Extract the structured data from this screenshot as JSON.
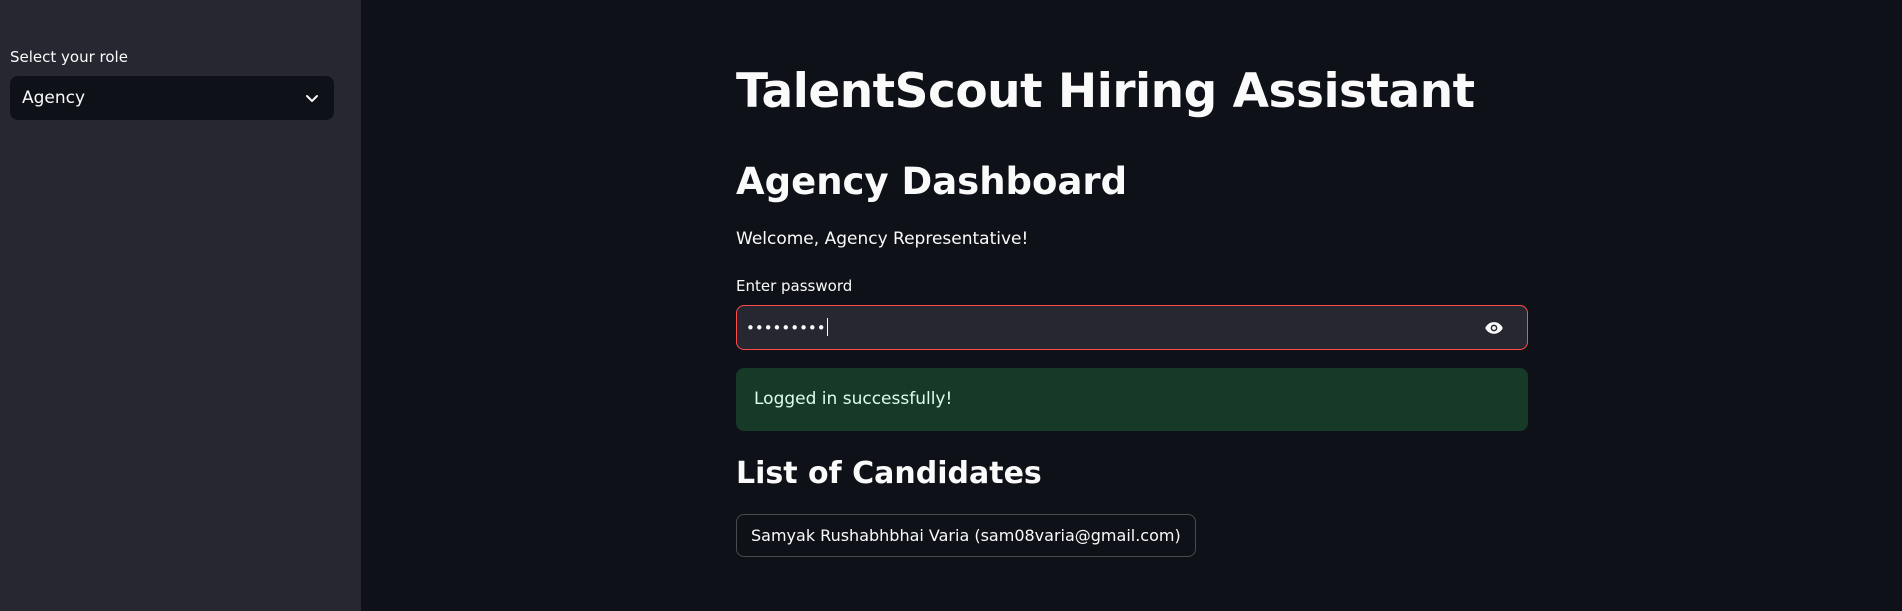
{
  "sidebar": {
    "role_label": "Select your role",
    "role_selected": "Agency"
  },
  "main": {
    "title": "TalentScout Hiring Assistant",
    "subtitle": "Agency Dashboard",
    "welcome": "Welcome, Agency Representative!",
    "password_label": "Enter password",
    "password_value": "•••••••••",
    "success_message": "Logged in successfully!",
    "list_title": "List of Candidates",
    "candidates": [
      "Samyak Rushabhbhai Varia (sam08varia@gmail.com)"
    ]
  },
  "colors": {
    "background": "#0e1117",
    "sidebar": "#262730",
    "input_border_error": "#ff4b4b",
    "success_bg": "#173928",
    "success_text": "#dffde9"
  },
  "icons": {
    "select_chevron": "chevron-down-icon",
    "password_toggle": "eye-icon"
  }
}
